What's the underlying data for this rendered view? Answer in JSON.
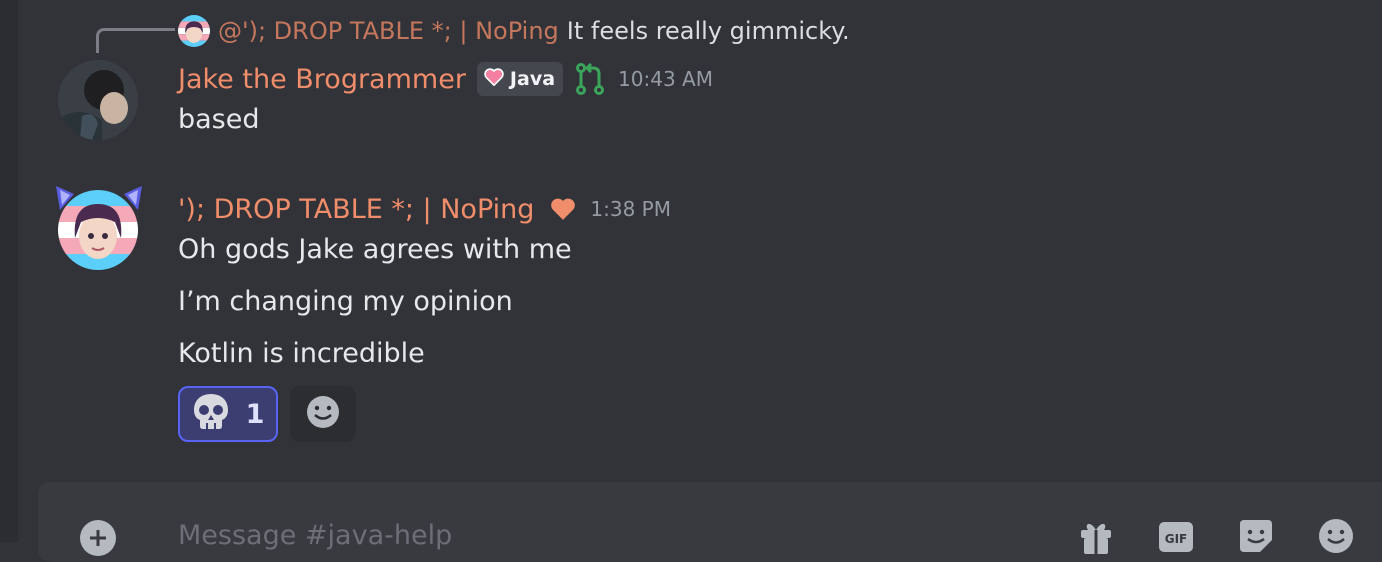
{
  "reply": {
    "name": "@'); DROP TABLE *; | NoPing",
    "text": "It feels really gimmicky."
  },
  "messages": [
    {
      "author": "Jake the Brogrammer",
      "badge": "Java",
      "timestamp": "10:43 AM",
      "lines": [
        "based"
      ]
    },
    {
      "author": "'); DROP TABLE *; | NoPing",
      "timestamp": "1:38 PM",
      "lines": [
        "Oh gods Jake agrees with me",
        "I’m changing my opinion",
        "Kotlin is incredible"
      ]
    }
  ],
  "reactions": [
    {
      "emoji": "skull",
      "count": "1"
    }
  ],
  "composer": {
    "placeholder": "Message #java-help"
  },
  "icons": {
    "badge": "heart-icon",
    "role": "git-pull-request-icon",
    "heart": "heart-icon",
    "add_reaction": "emoji-add-icon",
    "plus": "plus-circle-icon",
    "gift": "gift-icon",
    "gif": "gif-icon",
    "sticker": "sticker-icon",
    "emoji": "emoji-icon"
  },
  "colors": {
    "background": "#323338",
    "username": "#f08d6b",
    "reply_name": "#c4775c",
    "accent": "#5865f2",
    "role_icon": "#3ba55c"
  }
}
